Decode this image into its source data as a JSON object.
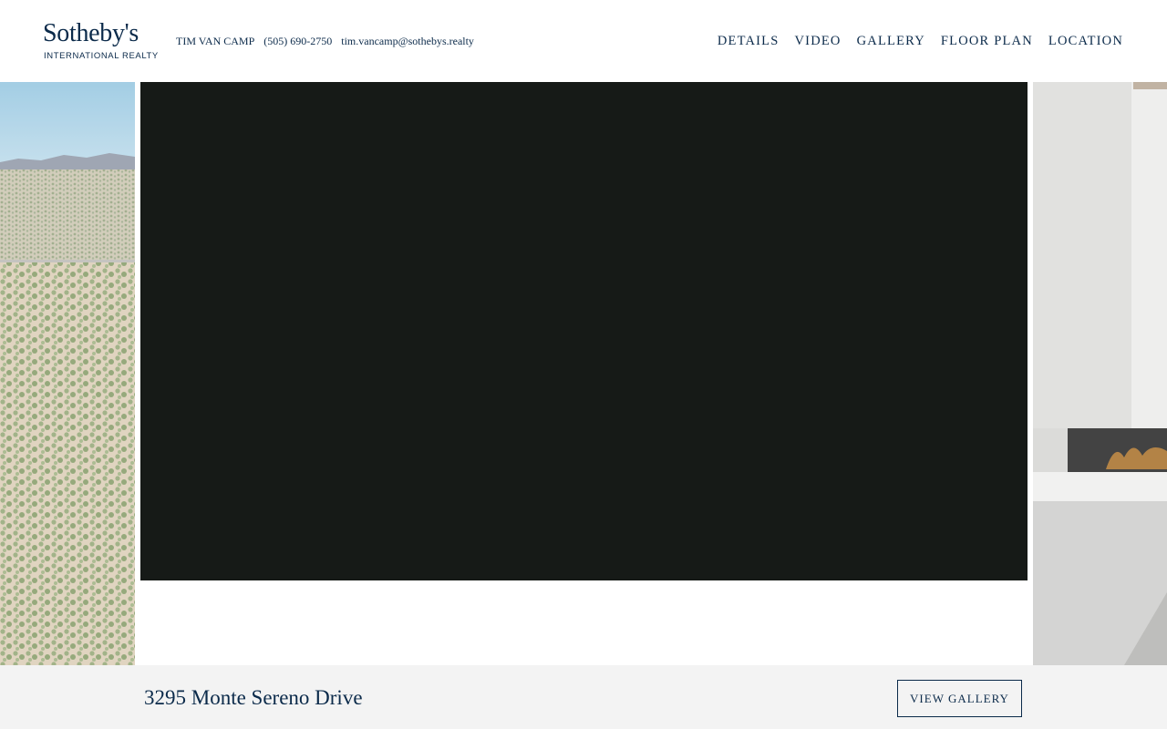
{
  "brand": {
    "name": "Sotheby's",
    "subtitle": "INTERNATIONAL REALTY",
    "color": "#0b2a4a"
  },
  "agent": {
    "name": "TIM VAN CAMP",
    "phone": "(505) 690-2750",
    "email": "tim.vancamp@sothebys.realty"
  },
  "nav": {
    "items": [
      "DETAILS",
      "VIDEO",
      "GALLERY",
      "FLOOR PLAN",
      "LOCATION"
    ]
  },
  "hero": {
    "left_image": "aerial-desert-landscape-photo",
    "right_image": "interior-fireplace-photo",
    "video_background": "#161a17"
  },
  "footer": {
    "address": "3295 Monte Sereno Drive",
    "view_gallery_label": "VIEW GALLERY",
    "background": "#f3f3f3"
  }
}
